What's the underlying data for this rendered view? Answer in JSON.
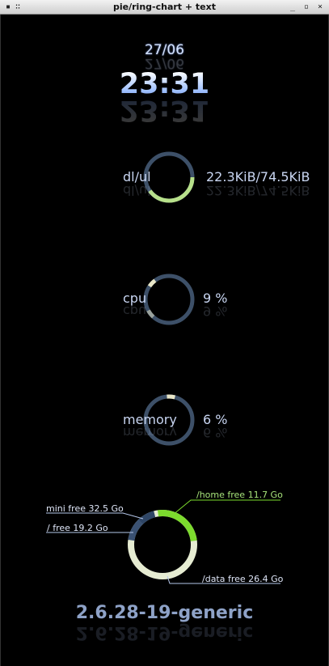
{
  "window": {
    "title": "pie/ring-chart + text"
  },
  "clock": {
    "date": "27/06",
    "time": "23:31"
  },
  "network": {
    "label": "dl/ul",
    "value": "22.3KiB/74.5KiB",
    "download_fraction": 0.4
  },
  "cpu": {
    "label": "cpu",
    "value": "9 %",
    "percent": 9
  },
  "memory": {
    "label": "memory",
    "value": "6 %",
    "percent": 6
  },
  "disks": [
    {
      "label": "/home free 11.7 Go",
      "color": "#7ddb2e"
    },
    {
      "label": "mini free 32.5 Go",
      "color": "#2f4666"
    },
    {
      "label": "/ free 19.2 Go",
      "color": "#3a5172"
    },
    {
      "label": "/data free 26.4 Go",
      "color": "#e6ecd2"
    }
  ],
  "kernel": "2.6.28-19-generic",
  "colors": {
    "ring_track": "#3d5068",
    "ring_green": "#b7e08a",
    "ring_light": "#e8e6c8"
  }
}
